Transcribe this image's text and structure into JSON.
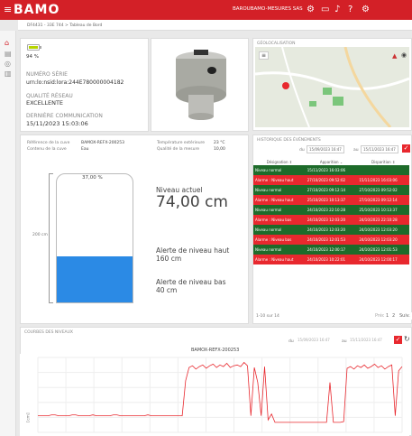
{
  "topbar": {
    "logo": "BAMO",
    "user": "BAROUBAMO-MESURES SAS",
    "icons": [
      "settings-icon",
      "chat-icon",
      "bell-icon",
      "help-icon",
      "gears-icon"
    ]
  },
  "breadcrumb": "DF4431 - 33E 744 > Tableau de Bord",
  "device": {
    "battery_pct": "94 %",
    "serial_label": "NUMÉRO SÉRIE",
    "serial_value": "urn:lo:nsid:lora:244E780000004182",
    "network_label": "QUALITÉ RÉSEAU",
    "network_value": "EXCELLENTE",
    "lastcomm_label": "DERNIÈRE COMMUNICATION",
    "lastcomm_value": "15/11/2023 15:03:06"
  },
  "map": {
    "title": "GÉOLOCALISATION"
  },
  "tank": {
    "ref_label": "Référence de la cuve",
    "ref_value": "BAMOX-REFX-200253",
    "content_label": "Contenu de la cuve",
    "content_value": "Eau",
    "temp_label": "Température extérieure",
    "temp_value": "23 °C",
    "quality_label": "Qualité de la mesure",
    "quality_value": "10,00",
    "top_label": "37,00 %",
    "side_label": "200 cm",
    "fill_fraction": 0.36,
    "level_label": "Niveau actuel",
    "level_value": "74,00 cm",
    "high_label": "Alerte de niveau haut",
    "high_value": "160 cm",
    "low_label": "Alerte de niveau bas",
    "low_value": "40 cm"
  },
  "events": {
    "title": "HISTORIQUE DES ÉVÉNEMENTS",
    "from_label": "du",
    "from_value": "15/09/2023 16:47",
    "to_label": "au",
    "to_value": "15/11/2023 16:47",
    "headers": [
      "Désignation ⇕",
      "Apparition ⌄",
      "Disparition ⇕"
    ],
    "rows": [
      {
        "type": "g",
        "d": "Niveau normal",
        "a": "15/11/2023 16:03:06",
        "p": ""
      },
      {
        "type": "r",
        "d": "Alarme : Niveau haut",
        "a": "27/10/2023 09:52:02",
        "p": "15/11/2023 16:03:06"
      },
      {
        "type": "g",
        "d": "Niveau normal",
        "a": "27/10/2023 09:12:14",
        "p": "27/10/2023 09:52:02"
      },
      {
        "type": "r",
        "d": "Alarme : Niveau haut",
        "a": "25/10/2023 10:13:37",
        "p": "27/10/2023 09:12:14"
      },
      {
        "type": "g",
        "d": "Niveau normal",
        "a": "24/10/2023 22:10:28",
        "p": "25/10/2023 10:13:37"
      },
      {
        "type": "r",
        "d": "Alarme : Niveau bas",
        "a": "24/10/2023 12:03:20",
        "p": "24/10/2023 22:10:28"
      },
      {
        "type": "g",
        "d": "Niveau normal",
        "a": "24/10/2023 12:03:20",
        "p": "24/10/2023 12:03:20"
      },
      {
        "type": "r",
        "d": "Alarme : Niveau bas",
        "a": "24/10/2023 12:01:53",
        "p": "24/10/2023 12:03:20"
      },
      {
        "type": "g",
        "d": "Niveau normal",
        "a": "24/10/2023 12:00:17",
        "p": "24/10/2023 12:01:53"
      },
      {
        "type": "r",
        "d": "Alarme : Niveau haut",
        "a": "24/10/2023 10:22:01",
        "p": "24/10/2023 12:00:17"
      }
    ],
    "pagination": "1-10 sur 14",
    "prev": "Préc.",
    "page1": "1",
    "page2": "2",
    "next": "Suiv."
  },
  "levels": {
    "title": "COURBES DES NIVEAUX",
    "from_label": "du",
    "from_value": "15/09/2023 16:47",
    "to_label": "au",
    "to_value": "15/11/2023 16:47",
    "chart_title": "BAMOX-REFX-200253",
    "ylabel": "[cm]"
  },
  "chart_data": {
    "type": "line",
    "title": "BAMOX-REFX-200253",
    "ylabel": "[cm]",
    "color": "#e8282e",
    "series": [
      {
        "values": [
          20,
          20,
          20,
          20,
          21,
          21,
          20,
          20,
          20,
          20,
          21,
          21,
          20,
          20,
          20,
          20,
          21,
          20,
          20,
          20,
          20,
          20,
          21,
          21,
          20,
          20,
          20,
          20,
          20,
          20,
          20,
          20,
          21,
          20,
          20,
          20,
          20,
          20,
          20,
          20,
          20,
          20,
          20,
          62,
          78,
          80,
          76,
          79,
          81,
          77,
          80,
          82,
          78,
          81,
          79,
          83,
          78,
          80,
          81,
          79,
          84,
          80,
          20,
          78,
          60,
          20,
          79,
          15,
          22,
          12,
          12,
          12,
          12,
          12,
          12,
          12,
          12,
          12,
          12,
          12,
          12,
          12,
          12,
          12,
          12,
          60,
          12,
          12,
          12,
          13,
          77,
          79,
          76,
          80,
          78,
          81,
          77,
          79,
          82,
          78,
          80,
          76,
          79,
          81,
          20,
          74,
          79
        ]
      }
    ]
  }
}
